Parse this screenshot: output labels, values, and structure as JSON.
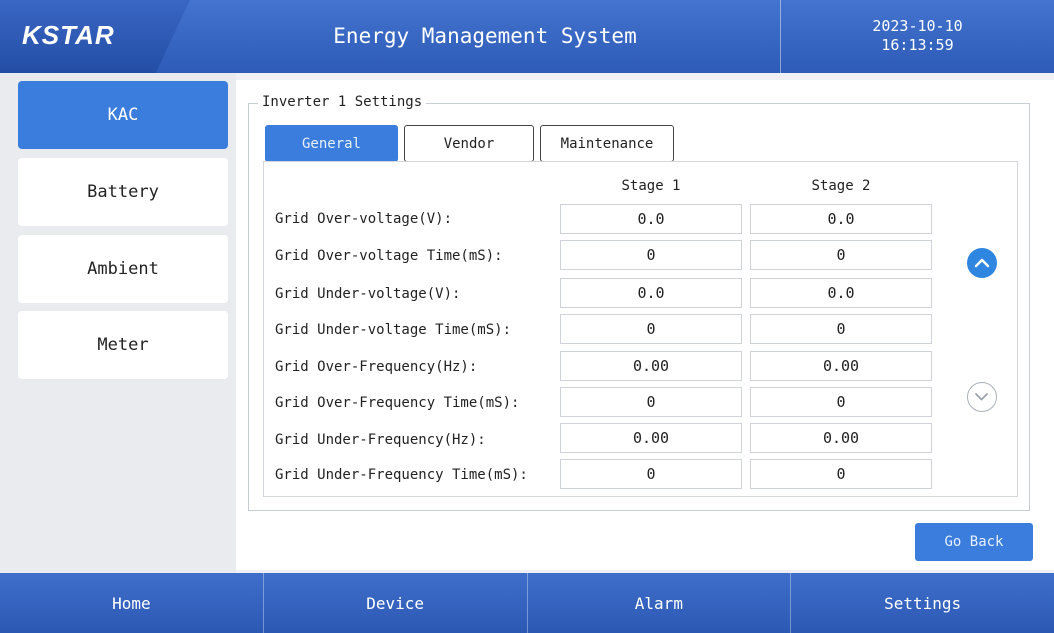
{
  "header": {
    "logo": "KSTAR",
    "title": "Energy Management System",
    "date": "2023-10-10",
    "time": "16:13:59"
  },
  "sidebar": {
    "items": [
      {
        "label": "KAC",
        "active": true
      },
      {
        "label": "Battery",
        "active": false
      },
      {
        "label": "Ambient",
        "active": false
      },
      {
        "label": "Meter",
        "active": false
      }
    ]
  },
  "section_title": "Inverter 1 Settings",
  "tabs": [
    {
      "label": "General",
      "active": true
    },
    {
      "label": "Vendor",
      "active": false
    },
    {
      "label": "Maintenance",
      "active": false
    }
  ],
  "table": {
    "columns": [
      "Stage 1",
      "Stage 2"
    ],
    "rows": [
      {
        "label": "Grid Over-voltage(V):",
        "stage1": "0.0",
        "stage2": "0.0"
      },
      {
        "label": "Grid Over-voltage Time(mS):",
        "stage1": "0",
        "stage2": "0"
      },
      {
        "label": "Grid Under-voltage(V):",
        "stage1": "0.0",
        "stage2": "0.0"
      },
      {
        "label": "Grid Under-voltage Time(mS):",
        "stage1": "0",
        "stage2": "0"
      },
      {
        "label": "Grid Over-Frequency(Hz):",
        "stage1": "0.00",
        "stage2": "0.00"
      },
      {
        "label": "Grid Over-Frequency Time(mS):",
        "stage1": "0",
        "stage2": "0"
      },
      {
        "label": "Grid Under-Frequency(Hz):",
        "stage1": "0.00",
        "stage2": "0.00"
      },
      {
        "label": "Grid Under-Frequency Time(mS):",
        "stage1": "0",
        "stage2": "0"
      }
    ]
  },
  "scroll": {
    "up_icon": "chevron-up-icon",
    "down_icon": "chevron-down-icon"
  },
  "go_back_label": "Go Back",
  "footer": {
    "items": [
      "Home",
      "Device",
      "Alarm",
      "Settings"
    ]
  },
  "colors": {
    "accent": "#3b7ddd",
    "header_bg": "#3565c2"
  }
}
